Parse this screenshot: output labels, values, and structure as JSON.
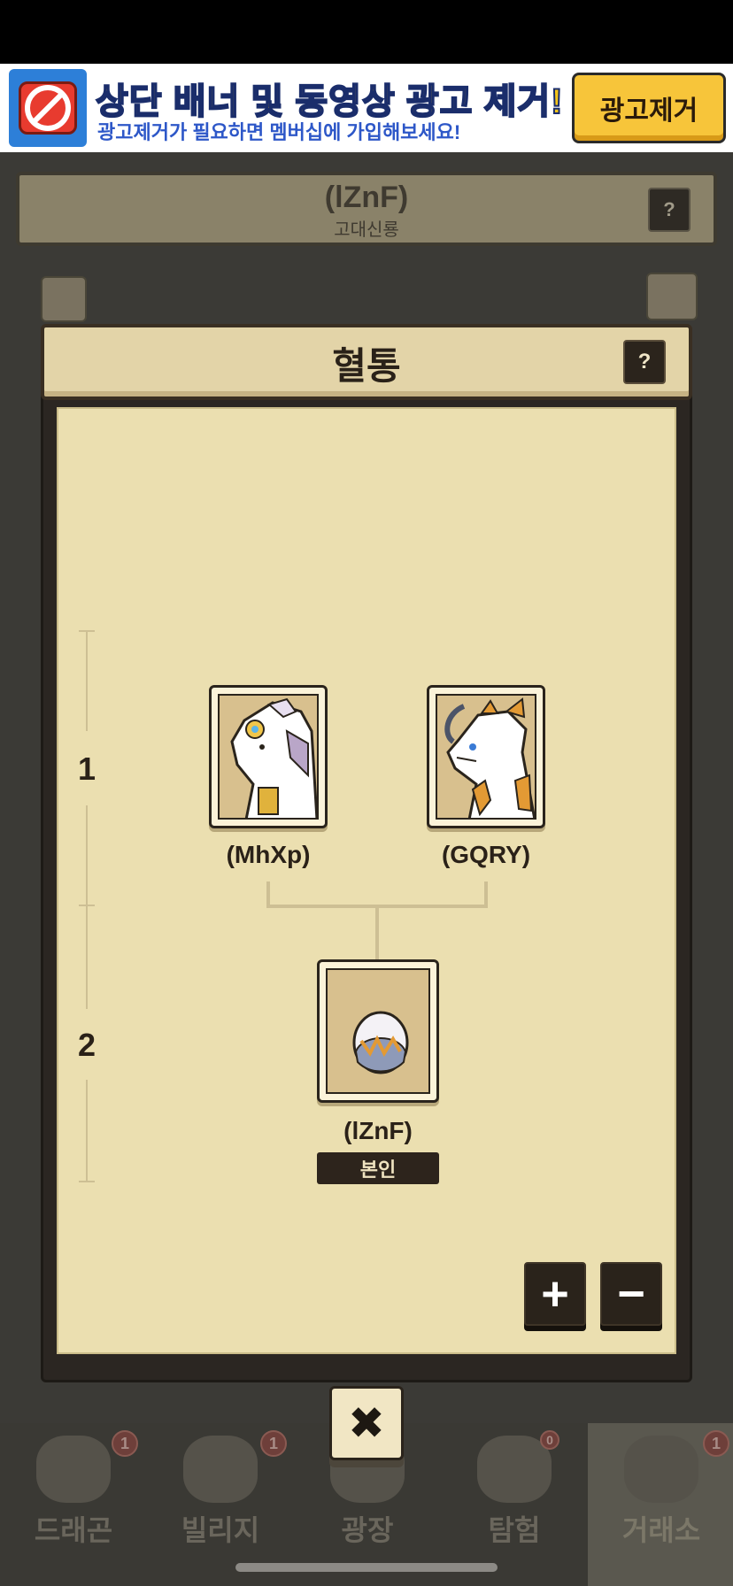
{
  "ad": {
    "title": "상단 배너 및 동영상 광고 제거!",
    "subtitle": "광고제거가 필요하면 멤버십에 가입해보세요!",
    "button_label": "광고제거"
  },
  "background": {
    "creature_name": "(lZnF)",
    "creature_type": "고대신룡",
    "help_label": "?",
    "nav": [
      {
        "label": "드래곤",
        "badge": "1"
      },
      {
        "label": "빌리지",
        "badge": "1"
      },
      {
        "label": "광장",
        "badge": ""
      },
      {
        "label": "탐험",
        "badge": "0"
      },
      {
        "label": "거래소",
        "badge": "1"
      }
    ]
  },
  "modal": {
    "title": "혈통",
    "help_label": "?",
    "generations": [
      "1",
      "2"
    ],
    "parents": [
      {
        "name": "(MhXp)"
      },
      {
        "name": "(GQRY)"
      }
    ],
    "self": {
      "name": "(lZnF)",
      "badge": "본인"
    },
    "zoom_in_label": "+",
    "zoom_out_label": "−",
    "close_label": "✖"
  }
}
